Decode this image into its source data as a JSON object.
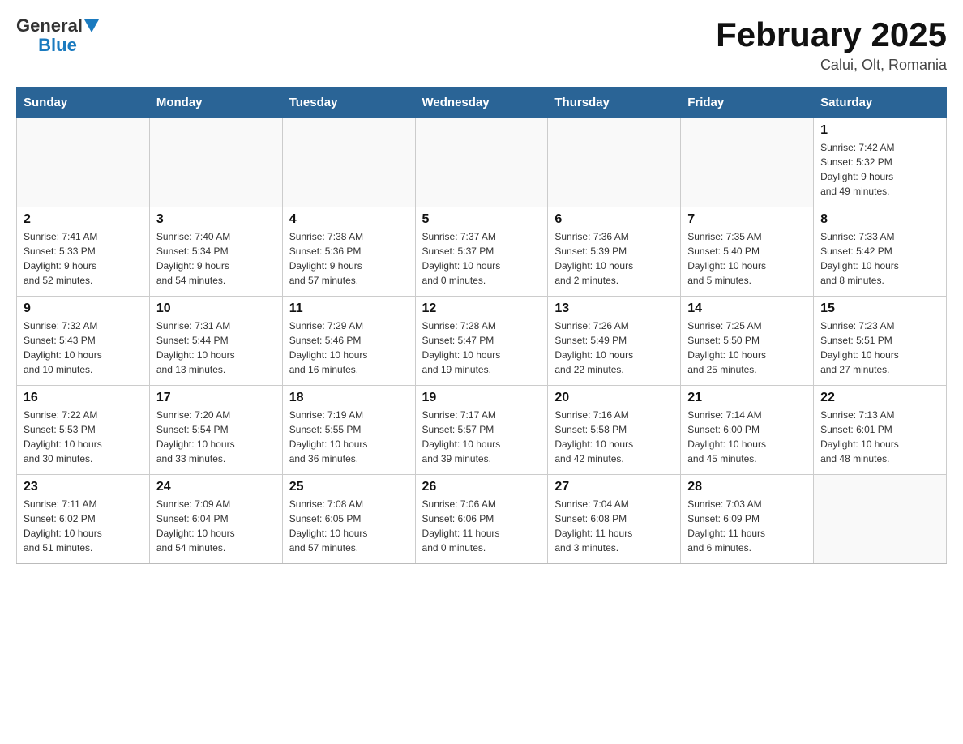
{
  "logo": {
    "general": "General",
    "blue": "Blue"
  },
  "title": "February 2025",
  "subtitle": "Calui, Olt, Romania",
  "headers": [
    "Sunday",
    "Monday",
    "Tuesday",
    "Wednesday",
    "Thursday",
    "Friday",
    "Saturday"
  ],
  "weeks": [
    [
      {
        "day": "",
        "info": ""
      },
      {
        "day": "",
        "info": ""
      },
      {
        "day": "",
        "info": ""
      },
      {
        "day": "",
        "info": ""
      },
      {
        "day": "",
        "info": ""
      },
      {
        "day": "",
        "info": ""
      },
      {
        "day": "1",
        "info": "Sunrise: 7:42 AM\nSunset: 5:32 PM\nDaylight: 9 hours\nand 49 minutes."
      }
    ],
    [
      {
        "day": "2",
        "info": "Sunrise: 7:41 AM\nSunset: 5:33 PM\nDaylight: 9 hours\nand 52 minutes."
      },
      {
        "day": "3",
        "info": "Sunrise: 7:40 AM\nSunset: 5:34 PM\nDaylight: 9 hours\nand 54 minutes."
      },
      {
        "day": "4",
        "info": "Sunrise: 7:38 AM\nSunset: 5:36 PM\nDaylight: 9 hours\nand 57 minutes."
      },
      {
        "day": "5",
        "info": "Sunrise: 7:37 AM\nSunset: 5:37 PM\nDaylight: 10 hours\nand 0 minutes."
      },
      {
        "day": "6",
        "info": "Sunrise: 7:36 AM\nSunset: 5:39 PM\nDaylight: 10 hours\nand 2 minutes."
      },
      {
        "day": "7",
        "info": "Sunrise: 7:35 AM\nSunset: 5:40 PM\nDaylight: 10 hours\nand 5 minutes."
      },
      {
        "day": "8",
        "info": "Sunrise: 7:33 AM\nSunset: 5:42 PM\nDaylight: 10 hours\nand 8 minutes."
      }
    ],
    [
      {
        "day": "9",
        "info": "Sunrise: 7:32 AM\nSunset: 5:43 PM\nDaylight: 10 hours\nand 10 minutes."
      },
      {
        "day": "10",
        "info": "Sunrise: 7:31 AM\nSunset: 5:44 PM\nDaylight: 10 hours\nand 13 minutes."
      },
      {
        "day": "11",
        "info": "Sunrise: 7:29 AM\nSunset: 5:46 PM\nDaylight: 10 hours\nand 16 minutes."
      },
      {
        "day": "12",
        "info": "Sunrise: 7:28 AM\nSunset: 5:47 PM\nDaylight: 10 hours\nand 19 minutes."
      },
      {
        "day": "13",
        "info": "Sunrise: 7:26 AM\nSunset: 5:49 PM\nDaylight: 10 hours\nand 22 minutes."
      },
      {
        "day": "14",
        "info": "Sunrise: 7:25 AM\nSunset: 5:50 PM\nDaylight: 10 hours\nand 25 minutes."
      },
      {
        "day": "15",
        "info": "Sunrise: 7:23 AM\nSunset: 5:51 PM\nDaylight: 10 hours\nand 27 minutes."
      }
    ],
    [
      {
        "day": "16",
        "info": "Sunrise: 7:22 AM\nSunset: 5:53 PM\nDaylight: 10 hours\nand 30 minutes."
      },
      {
        "day": "17",
        "info": "Sunrise: 7:20 AM\nSunset: 5:54 PM\nDaylight: 10 hours\nand 33 minutes."
      },
      {
        "day": "18",
        "info": "Sunrise: 7:19 AM\nSunset: 5:55 PM\nDaylight: 10 hours\nand 36 minutes."
      },
      {
        "day": "19",
        "info": "Sunrise: 7:17 AM\nSunset: 5:57 PM\nDaylight: 10 hours\nand 39 minutes."
      },
      {
        "day": "20",
        "info": "Sunrise: 7:16 AM\nSunset: 5:58 PM\nDaylight: 10 hours\nand 42 minutes."
      },
      {
        "day": "21",
        "info": "Sunrise: 7:14 AM\nSunset: 6:00 PM\nDaylight: 10 hours\nand 45 minutes."
      },
      {
        "day": "22",
        "info": "Sunrise: 7:13 AM\nSunset: 6:01 PM\nDaylight: 10 hours\nand 48 minutes."
      }
    ],
    [
      {
        "day": "23",
        "info": "Sunrise: 7:11 AM\nSunset: 6:02 PM\nDaylight: 10 hours\nand 51 minutes."
      },
      {
        "day": "24",
        "info": "Sunrise: 7:09 AM\nSunset: 6:04 PM\nDaylight: 10 hours\nand 54 minutes."
      },
      {
        "day": "25",
        "info": "Sunrise: 7:08 AM\nSunset: 6:05 PM\nDaylight: 10 hours\nand 57 minutes."
      },
      {
        "day": "26",
        "info": "Sunrise: 7:06 AM\nSunset: 6:06 PM\nDaylight: 11 hours\nand 0 minutes."
      },
      {
        "day": "27",
        "info": "Sunrise: 7:04 AM\nSunset: 6:08 PM\nDaylight: 11 hours\nand 3 minutes."
      },
      {
        "day": "28",
        "info": "Sunrise: 7:03 AM\nSunset: 6:09 PM\nDaylight: 11 hours\nand 6 minutes."
      },
      {
        "day": "",
        "info": ""
      }
    ]
  ]
}
